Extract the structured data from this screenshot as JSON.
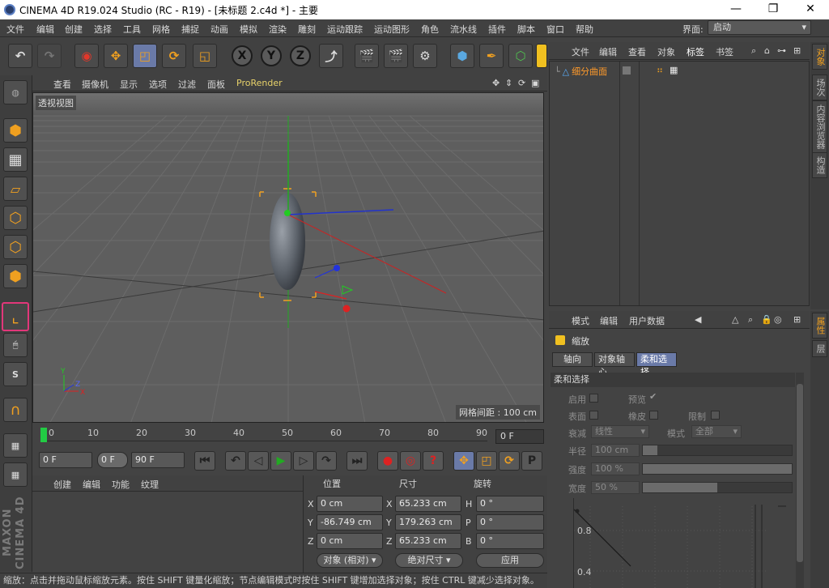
{
  "window": {
    "title": "CINEMA 4D R19.024 Studio (RC - R19) - [未标题 2.c4d *] - 主要",
    "minimize": "—",
    "maximize": "❐",
    "close": "✕"
  },
  "menubar": {
    "items": [
      "文件",
      "编辑",
      "创建",
      "选择",
      "工具",
      "网格",
      "捕捉",
      "动画",
      "模拟",
      "渲染",
      "雕刻",
      "运动跟踪",
      "运动图形",
      "角色",
      "流水线",
      "插件",
      "脚本",
      "窗口",
      "帮助"
    ],
    "layout_label": "界面:",
    "layout_value": "启动"
  },
  "toolbar": {
    "x_label": "X",
    "y_label": "Y",
    "z_label": "Z"
  },
  "viewport": {
    "menu": [
      "查看",
      "摄像机",
      "显示",
      "选项",
      "过滤",
      "面板",
      "ProRender"
    ],
    "label": "透视视图",
    "grid_info": "网格间距 : 100 cm",
    "axis_x": "X",
    "axis_y": "Y",
    "axis_z": "Z"
  },
  "timeline": {
    "ticks": [
      "0",
      "10",
      "20",
      "30",
      "40",
      "50",
      "60",
      "70",
      "80",
      "90"
    ],
    "current_frame": "0 F"
  },
  "transport": {
    "start_frame": "0 F",
    "mini_frame": "0 F",
    "end_frame": "90 F"
  },
  "material_manager": {
    "menu": [
      "创建",
      "编辑",
      "功能",
      "纹理"
    ]
  },
  "coordinates": {
    "headers": {
      "position": "位置",
      "size": "尺寸",
      "rotation": "旋转"
    },
    "rows": [
      {
        "axis": "X",
        "pos": "0 cm",
        "size_axis": "X",
        "size": "65.233 cm",
        "rot_axis": "H",
        "rot": "0 °"
      },
      {
        "axis": "Y",
        "pos": "-86.749 cm",
        "size_axis": "Y",
        "size": "179.263 cm",
        "rot_axis": "P",
        "rot": "0 °"
      },
      {
        "axis": "Z",
        "pos": "0 cm",
        "size_axis": "Z",
        "size": "65.233 cm",
        "rot_axis": "B",
        "rot": "0 °"
      }
    ],
    "mode_select": "对象 (相对)",
    "size_select": "绝对尺寸",
    "apply": "应用"
  },
  "status": "缩放：点击并拖动鼠标缩放元素。按住 SHIFT 键量化缩放；节点编辑模式时按住 SHIFT 键增加选择对象；按住 CTRL 键减少选择对象。",
  "object_manager": {
    "menu": [
      "文件",
      "编辑",
      "查看",
      "对象",
      "标签",
      "书签"
    ],
    "objects": [
      {
        "name": "细分曲面"
      }
    ]
  },
  "side_tabs_top": [
    "对象",
    "场次",
    "内容浏览器",
    "构造"
  ],
  "side_tabs_bottom": [
    "属性",
    "层"
  ],
  "attributes": {
    "menu": [
      "模式",
      "编辑",
      "用户数据"
    ],
    "title": "缩放",
    "tabs": [
      "轴向",
      "对象轴心",
      "柔和选择"
    ],
    "active_tab": "柔和选择",
    "section": "柔和选择",
    "enable_label": "启用",
    "preview_label": "预览",
    "surface_label": "表面",
    "rubber_label": "橡皮",
    "limit_label": "限制",
    "falloff_label": "衰减",
    "falloff_value": "线性",
    "mode_label": "模式",
    "mode_value": "全部",
    "radius_label": "半径",
    "radius_value": "100 cm",
    "radius_fill": 0.1,
    "strength_label": "强度",
    "strength_value": "100 %",
    "strength_fill": 1.0,
    "width_label": "宽度",
    "width_value": "50 %",
    "width_fill": 0.5,
    "curve_labels": [
      "0.8",
      "0.4"
    ]
  },
  "colors": {
    "accent_orange": "#f0a020",
    "highlight_blue": "#6a7aa8",
    "selection_box": "#e2377a"
  }
}
